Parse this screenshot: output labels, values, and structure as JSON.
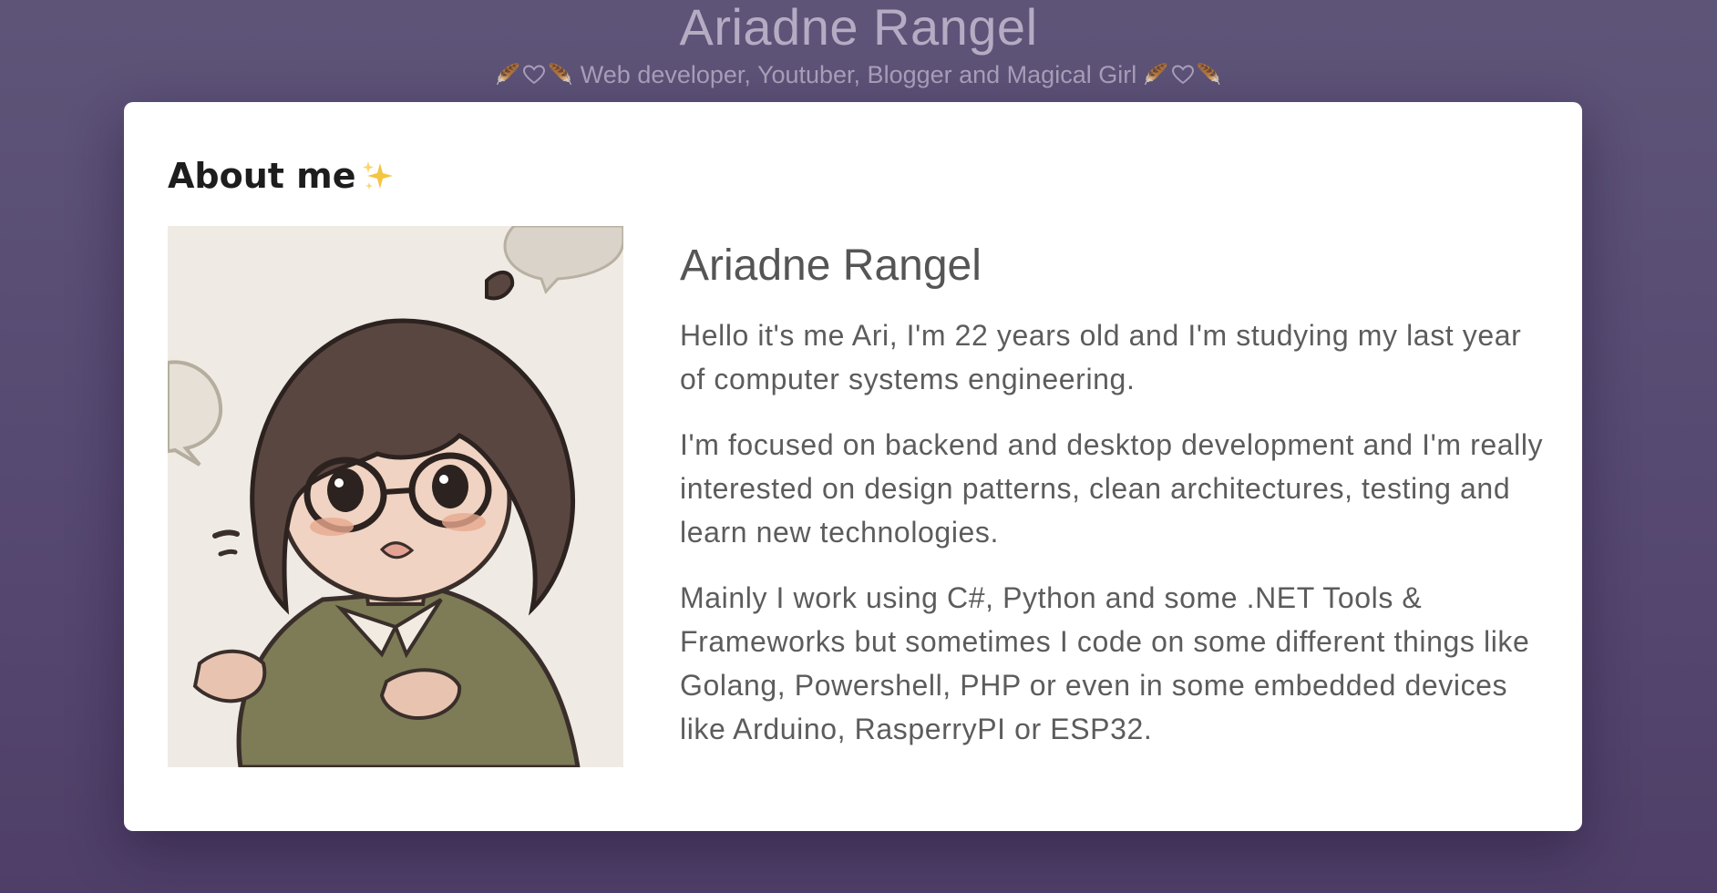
{
  "header": {
    "title": "Ariadne Rangel",
    "subtitle": "Web developer, Youtuber, Blogger and Magical Girl",
    "decoration_icons": [
      "wing-icon",
      "heart-icon",
      "wing-icon"
    ]
  },
  "about": {
    "heading": "About me",
    "heading_icon": "sparkles-icon",
    "avatar_icon": "avatar-illustration",
    "name": "Ariadne Rangel",
    "paragraphs": [
      "Hello it's me Ari, I'm 22 years old and I'm studying my last year of computer systems engineering.",
      "I'm focused on backend and desktop development and I'm really interested on design patterns, clean architectures, testing and learn new technologies.",
      "Mainly I work using C#, Python and some .NET Tools & Frameworks but sometimes I code on some different things like Golang, Powershell, PHP or even in some embedded devices like Arduino, RasperryPI or ESP32."
    ]
  },
  "colors": {
    "background_top": "#5e5478",
    "background_bottom": "#4f3f68",
    "header_text": "#b5acc4",
    "card_background": "#ffffff",
    "heading_text": "#1d1d1d",
    "body_text": "#5c5c5c"
  }
}
